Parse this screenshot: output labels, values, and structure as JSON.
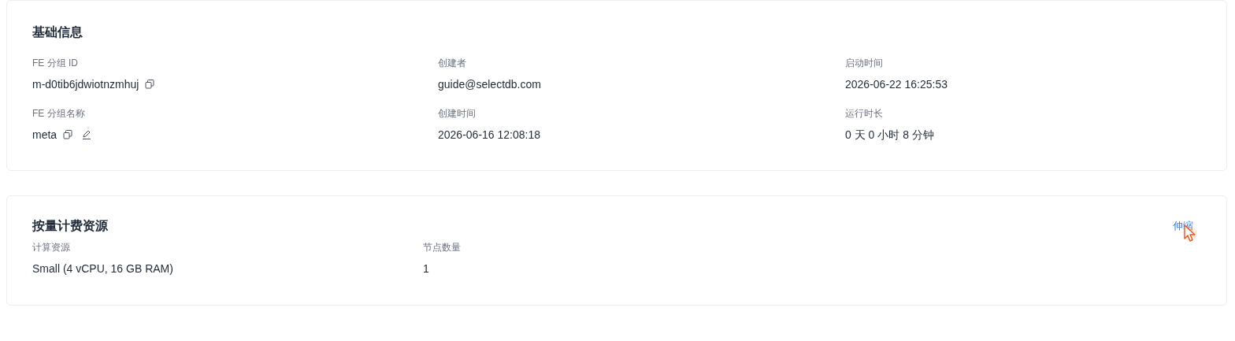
{
  "basic_info": {
    "title": "基础信息",
    "fields": [
      {
        "label": "FE 分组 ID",
        "value": "m-d0tib6jdwiotnzmhuj",
        "copyable": true,
        "editable": false
      },
      {
        "label": "创建者",
        "value": "guide@selectdb.com",
        "copyable": false,
        "editable": false
      },
      {
        "label": "启动时间",
        "value": "2026-06-22 16:25:53",
        "copyable": false,
        "editable": false
      },
      {
        "label": "FE 分组名称",
        "value": "meta",
        "copyable": true,
        "editable": true
      },
      {
        "label": "创建时间",
        "value": "2026-06-16 12:08:18",
        "copyable": false,
        "editable": false
      },
      {
        "label": "运行时长",
        "value": "0 天 0 小时 8 分钟",
        "copyable": false,
        "editable": false
      }
    ]
  },
  "billing": {
    "title": "按量计费资源",
    "action": "伸缩",
    "fields": [
      {
        "label": "计算资源",
        "value": "Small (4 vCPU, 16 GB RAM)"
      },
      {
        "label": "节点数量",
        "value": "1"
      }
    ]
  }
}
